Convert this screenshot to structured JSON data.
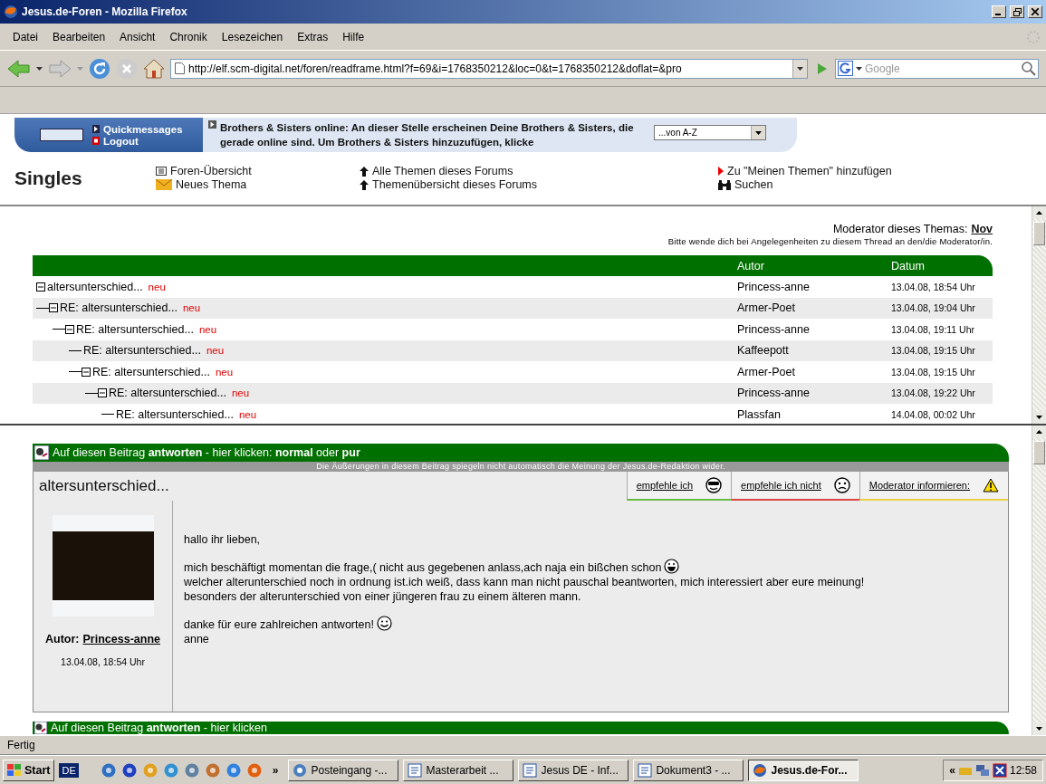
{
  "window": {
    "title": "Jesus.de-Foren - Mozilla Firefox"
  },
  "menu": [
    "Datei",
    "Bearbeiten",
    "Ansicht",
    "Chronik",
    "Lesezeichen",
    "Extras",
    "Hilfe"
  ],
  "address": {
    "value": "http://elf.scm-digital.net/foren/readframe.html?f=69&i=1768350212&loc=0&t=1768350212&doflat=&pro"
  },
  "search": {
    "placeholder": "Google"
  },
  "banner": {
    "links": [
      {
        "label": "Quickmessages",
        "kind": "play"
      },
      {
        "label": "Logout",
        "kind": "stop"
      }
    ],
    "online_text": "Brothers & Sisters online: An dieser Stelle erscheinen Deine Brothers & Sisters, die gerade online sind. Um Brothers & Sisters hinzuzufügen, klicke",
    "sort_select": "...von A-Z"
  },
  "forum": {
    "title": "Singles",
    "links": [
      {
        "label": "Foren-Übersicht",
        "kind": "list"
      },
      {
        "label": "Alle Themen dieses Forums",
        "kind": "arrow"
      },
      {
        "label": "Zu \"Meinen Themen\" hinzufügen",
        "kind": "marker"
      },
      {
        "label": "Neues Thema",
        "kind": "mail"
      },
      {
        "label": "Themenübersicht dieses Forums",
        "kind": "arrow"
      },
      {
        "label": "Suchen",
        "kind": "binoculars"
      }
    ]
  },
  "moderator": {
    "label": "Moderator dieses Themas:",
    "name": "Nov",
    "note": "Bitte wende dich bei Angelegenheiten zu diesem Thread an den/die Moderator/in."
  },
  "thread": {
    "columns": [
      "Autor",
      "Datum"
    ],
    "rows": [
      {
        "title": "altersunterschied...",
        "badge": "neu",
        "author": "Princess-anne",
        "date": "13.04.08, 18:54 Uhr",
        "expanded": true,
        "children": [
          {
            "title": "RE: altersunterschied...",
            "badge": "neu",
            "author": "Armer-Poet",
            "date": "13.04.08, 19:04 Uhr",
            "expanded": true,
            "children": [
              {
                "title": "RE: altersunterschied...",
                "badge": "neu",
                "author": "Princess-anne",
                "date": "13.04.08, 19:11 Uhr",
                "expanded": true,
                "children": [
                  {
                    "title": "RE: altersunterschied...",
                    "badge": "neu",
                    "author": "Kaffeepott",
                    "date": "13.04.08, 19:15 Uhr"
                  },
                  {
                    "title": "RE: altersunterschied...",
                    "badge": "neu",
                    "author": "Armer-Poet",
                    "date": "13.04.08, 19:15 Uhr",
                    "expanded": true,
                    "children": [
                      {
                        "title": "RE: altersunterschied...",
                        "badge": "neu",
                        "author": "Princess-anne",
                        "date": "13.04.08, 19:22 Uhr",
                        "expanded": true,
                        "children": [
                          {
                            "title": "RE: altersunterschied...",
                            "badge": "neu",
                            "author": "Plassfan",
                            "date": "14.04.08, 00:02 Uhr"
                          }
                        ]
                      }
                    ]
                  }
                ]
              }
            ]
          }
        ]
      }
    ]
  },
  "post": {
    "reply_bar": "Auf diesen Beitrag **antworten** - hier klicken: **normal** oder **pur**",
    "disclaimer": "Die Äußerungen in diesem Beitrag spiegeln nicht automatisch die Meinung der Jesus.de-Redaktion wider.",
    "title": "altersunterschied...",
    "actions": [
      {
        "label": "empfehle ich",
        "kind": "cool",
        "color": "#66bb44"
      },
      {
        "label": "empfehle ich nicht",
        "kind": "sad",
        "color": "#dd4444"
      },
      {
        "label": "Moderator informieren:",
        "kind": "warning",
        "color": "#e8d040"
      }
    ],
    "author_label": "Autor:",
    "author": "Princess-anne",
    "date": "13.04.08, 18:54 Uhr",
    "paragraphs": [
      [
        {
          "text": "hallo ihr lieben,",
          "kind": "plain"
        }
      ],
      [
        {
          "text": "mich beschäftigt momentan die frage,( nicht aus gegebenen anlass,ach naja ein bißchen schon",
          "kind": "grin"
        },
        {
          "text": "welcher alterunterschied noch in ordnung ist.ich weiß, dass kann man nicht pauschal beantworten, mich interessiert aber eure meinung!",
          "kind": "plain"
        },
        {
          "text": "besonders der alterunterschied von einer jüngeren frau zu einem älteren mann.",
          "kind": "plain"
        }
      ],
      [
        {
          "text": "danke für eure zahlreichen antworten!",
          "kind": "smile"
        },
        {
          "text": "anne",
          "kind": "plain"
        }
      ]
    ],
    "next_reply_bar": "Auf diesen Beitrag **antworten** - hier klicken"
  },
  "status": "Fertig",
  "taskbar": {
    "start": "Start",
    "language": "DE",
    "overflow": "»",
    "tasks": [
      {
        "label": "Posteingang -...",
        "kind": "mail",
        "selected": false
      },
      {
        "label": "Masterarbeit ...",
        "kind": "doc",
        "selected": false
      },
      {
        "label": "Jesus DE - Inf...",
        "kind": "doc",
        "selected": false
      },
      {
        "label": "Dokument3 - ...",
        "kind": "doc",
        "selected": false
      },
      {
        "label": "Jesus.de-For...",
        "kind": "browser",
        "selected": true
      }
    ],
    "tray_toggle": "«",
    "clock": "12:58"
  }
}
